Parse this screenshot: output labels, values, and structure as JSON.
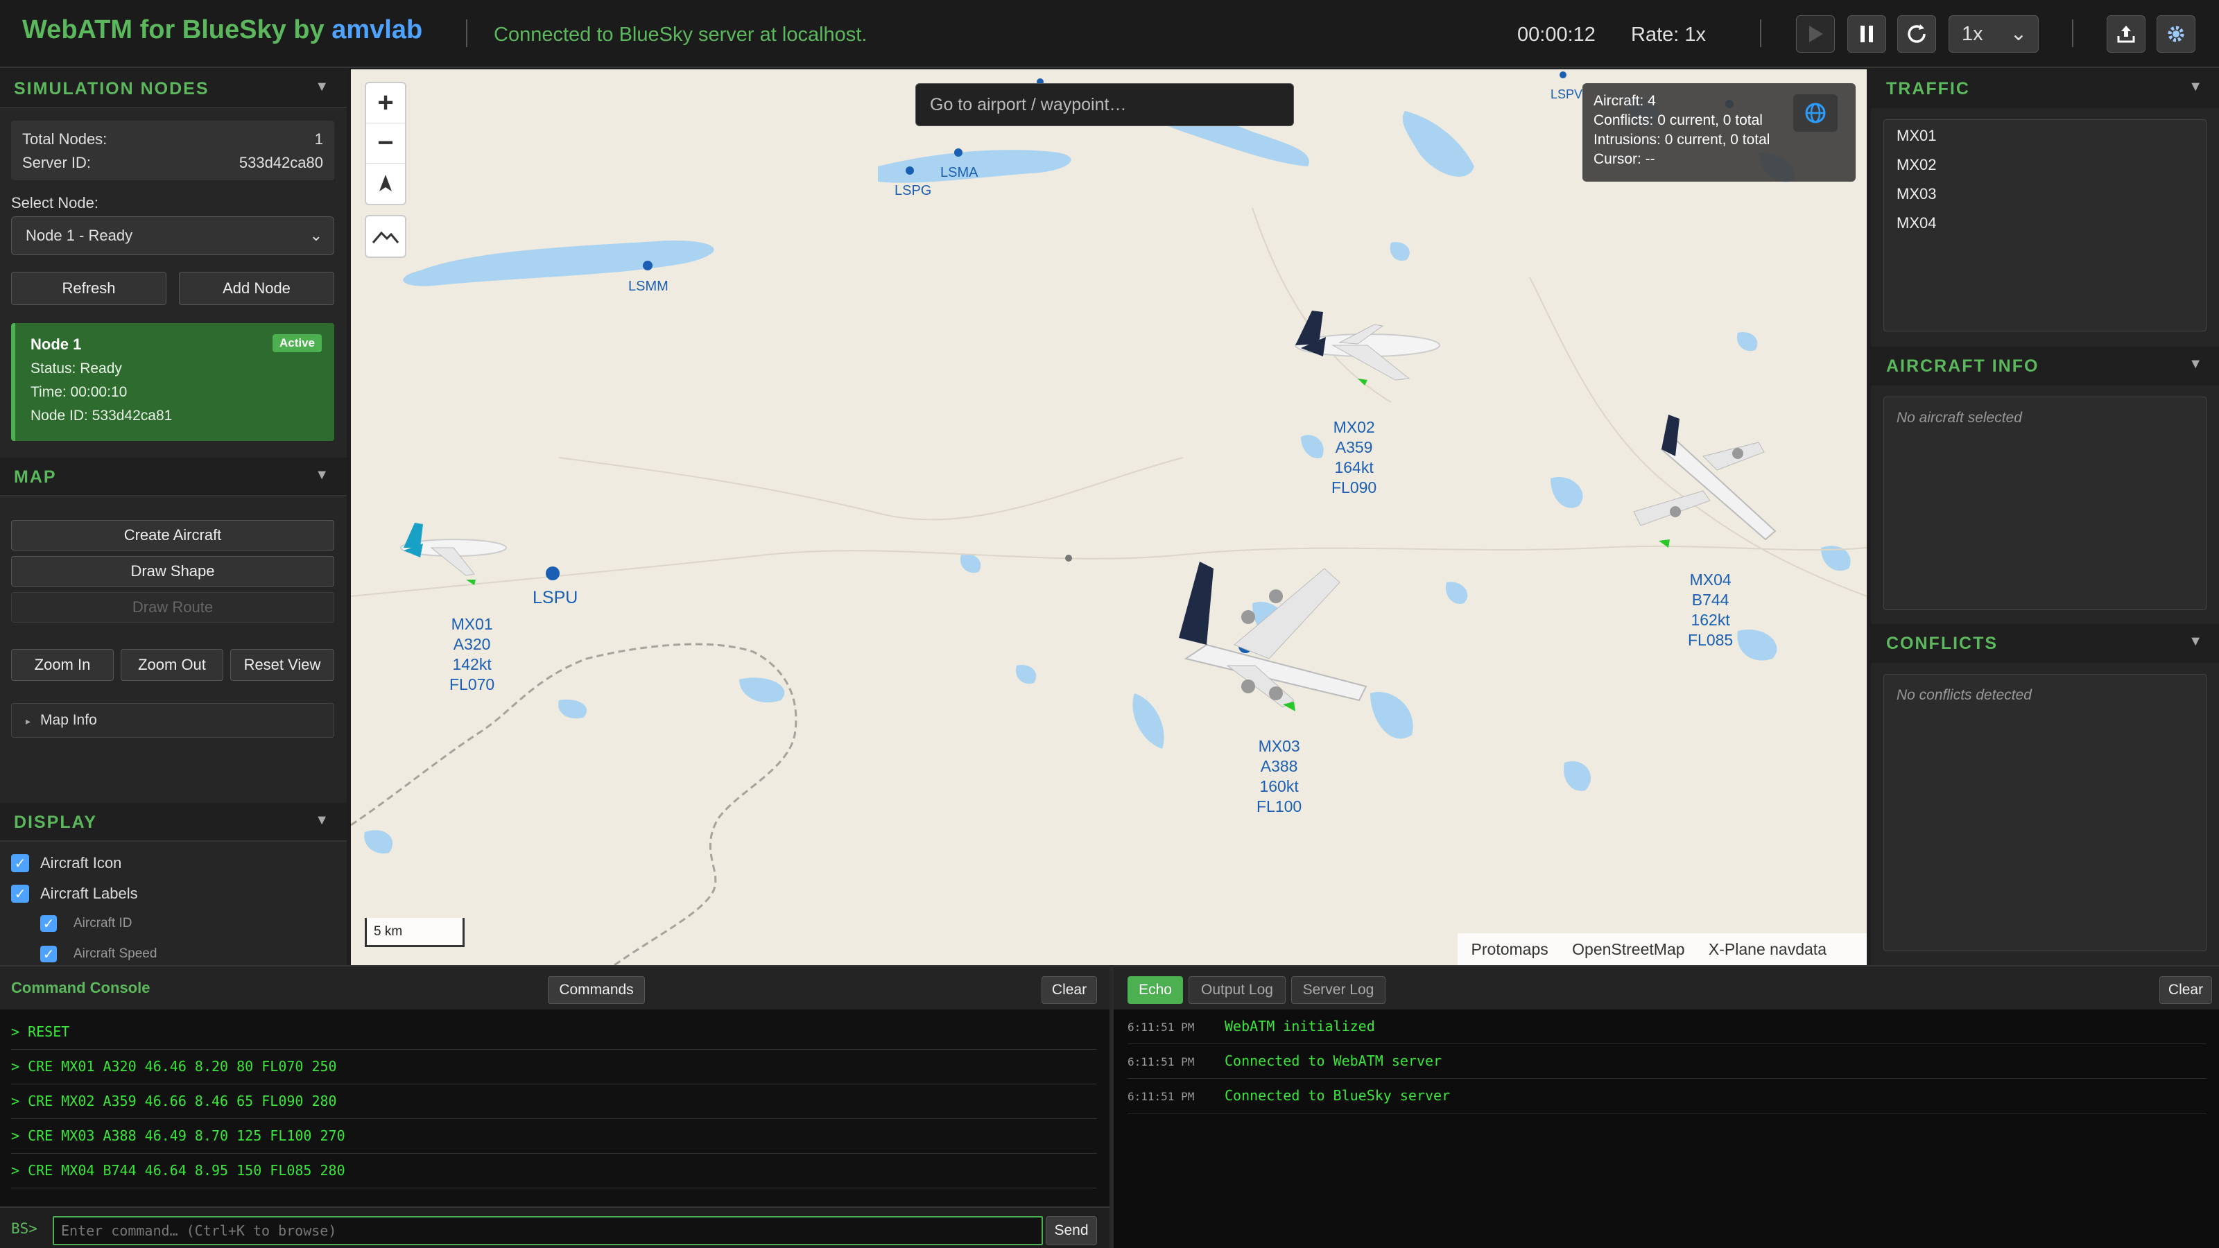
{
  "header": {
    "title_prefix": "WebATM for BlueSky by ",
    "title_brand": "amvlab",
    "connection": "Connected to BlueSky server at localhost.",
    "sim_time": "00:00:12",
    "rate": "Rate: 1x",
    "speed_value": "1x",
    "icons": [
      "play-icon",
      "pause-icon",
      "reset-icon",
      "upload-icon",
      "settings-icon"
    ]
  },
  "sim_nodes": {
    "heading": "SIMULATION NODES",
    "total_label": "Total Nodes:",
    "total_value": "1",
    "server_label": "Server ID:",
    "server_value": "533d42ca80",
    "select_label": "Select Node:",
    "selected_node": "Node 1 - Ready",
    "refresh": "Refresh",
    "add_node": "Add Node",
    "card": {
      "title": "Node 1",
      "badge": "Active",
      "status": "Status: Ready",
      "time": "Time: 00:00:10",
      "node_id": "Node ID: 533d42ca81"
    }
  },
  "map_section": {
    "heading": "MAP",
    "create_aircraft": "Create Aircraft",
    "draw_shape": "Draw Shape",
    "draw_route": "Draw Route",
    "zoom_in": "Zoom In",
    "zoom_out": "Zoom Out",
    "reset_view": "Reset View",
    "map_info": "Map Info"
  },
  "display": {
    "heading": "DISPLAY",
    "aircraft_icon": "Aircraft Icon",
    "aircraft_labels": "Aircraft Labels",
    "aircraft_id": "Aircraft ID",
    "aircraft_speed": "Aircraft Speed"
  },
  "map": {
    "search_placeholder": "Go to airport / waypoint…",
    "stats": {
      "aircraft": "Aircraft: 4",
      "conflicts": "Conflicts: 0 current, 0 total",
      "intrusions": "Intrusions: 0 current, 0 total",
      "cursor": "Cursor: --"
    },
    "waypoints": [
      "LSPV",
      "LSMA",
      "LSPG",
      "LSMM",
      "LSPU"
    ],
    "aircraft": [
      {
        "id": "MX01",
        "type": "A320",
        "speed": "142kt",
        "fl": "FL070"
      },
      {
        "id": "MX02",
        "type": "A359",
        "speed": "164kt",
        "fl": "FL090"
      },
      {
        "id": "MX03",
        "type": "A388",
        "speed": "160kt",
        "fl": "FL100"
      },
      {
        "id": "MX04",
        "type": "B744",
        "speed": "162kt",
        "fl": "FL085"
      }
    ],
    "scale": "5 km",
    "attribution": [
      "Protomaps",
      "OpenStreetMap",
      "X-Plane navdata"
    ],
    "colors": {
      "water": "#a9d3f0",
      "land": "#efebe0",
      "label": "#1a5fb4"
    }
  },
  "traffic": {
    "heading": "TRAFFIC",
    "items": [
      "MX01",
      "MX02",
      "MX03",
      "MX04"
    ]
  },
  "aircraft_info": {
    "heading": "AIRCRAFT INFO",
    "empty": "No aircraft selected"
  },
  "conflicts": {
    "heading": "CONFLICTS",
    "empty": "No conflicts detected"
  },
  "console": {
    "title": "Command Console",
    "commands_btn": "Commands",
    "clear_btn": "Clear",
    "lines": [
      "> RESET",
      "> CRE MX01 A320 46.46 8.20 80 FL070 250",
      "> CRE MX02 A359 46.66 8.46 65 FL090 280",
      "> CRE MX03 A388 46.49 8.70 125 FL100 270",
      "> CRE MX04 B744 46.64 8.95 150 FL085 280"
    ],
    "prompt": "BS>",
    "input_placeholder": "Enter command… (Ctrl+K to browse)",
    "send": "Send"
  },
  "log": {
    "tabs": [
      "Echo",
      "Output Log",
      "Server Log"
    ],
    "active_tab": "Echo",
    "clear_btn": "Clear",
    "entries": [
      {
        "time": "6:11:51 PM",
        "msg": "WebATM initialized"
      },
      {
        "time": "6:11:51 PM",
        "msg": "Connected to WebATM server"
      },
      {
        "time": "6:11:51 PM",
        "msg": "Connected to BlueSky server"
      }
    ]
  }
}
